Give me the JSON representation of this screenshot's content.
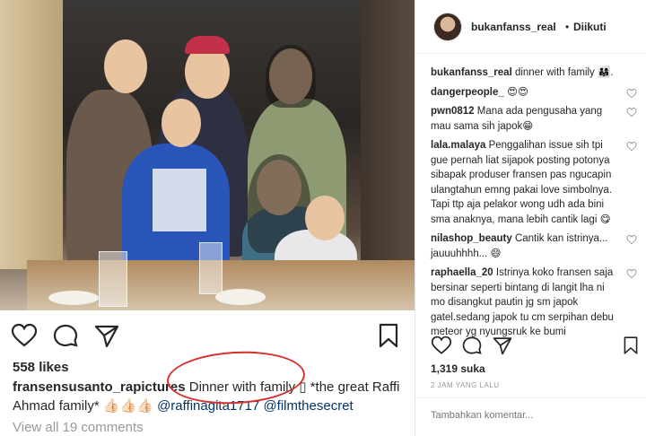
{
  "post": {
    "likes": "558 likes",
    "caption_user": "fransensusanto_rapictures",
    "caption_text": " Dinner with family ",
    "caption_rest": " *the great Raffi Ahmad family* ",
    "emoji_hands": "👍🏻👍🏻👍🏻",
    "mention_1": "@raffinagita1717",
    "mention_2": "@filmthesecret",
    "view_all": "View all 19 comments",
    "box_emoji": "▯"
  },
  "side": {
    "username": "bukanfanss_real",
    "dot": "•",
    "follow_status": "Diikuti",
    "comments": [
      {
        "user": "bukanfanss_real",
        "text": " dinner with family 👨‍👩‍👧."
      },
      {
        "user": "dangerpeople_",
        "text": " 😍😍"
      },
      {
        "user": "pwn0812",
        "text": " Mana ada pengusaha yang mau sama sih japok😁"
      },
      {
        "user": "lala.malaya",
        "text": " Penggalihan issue sih tpi gue pernah liat sijapok posting potonya sibapak produser fransen pas ngucapin ulangtahun emng pakai love simbolnya. Tapi ttp aja pelakor wong udh ada bini sma anaknya, mana lebih cantik lagi 😋"
      },
      {
        "user": "nilashop_beauty",
        "text": " Cantik kan istrinya... jauuuhhhh... 😄"
      },
      {
        "user": "raphaella_20",
        "text": " Istrinya koko fransen saja bersinar seperti bintang di langit lha ni mo disangkut pautin jg sm japok gatel.sedang japok tu cm serpihan debu meteor yg nyungsruk ke bumi"
      }
    ],
    "likes": "1,319 suka",
    "time": "2 JAM YANG LALU",
    "comment_placeholder": "Tambahkan komentar..."
  }
}
